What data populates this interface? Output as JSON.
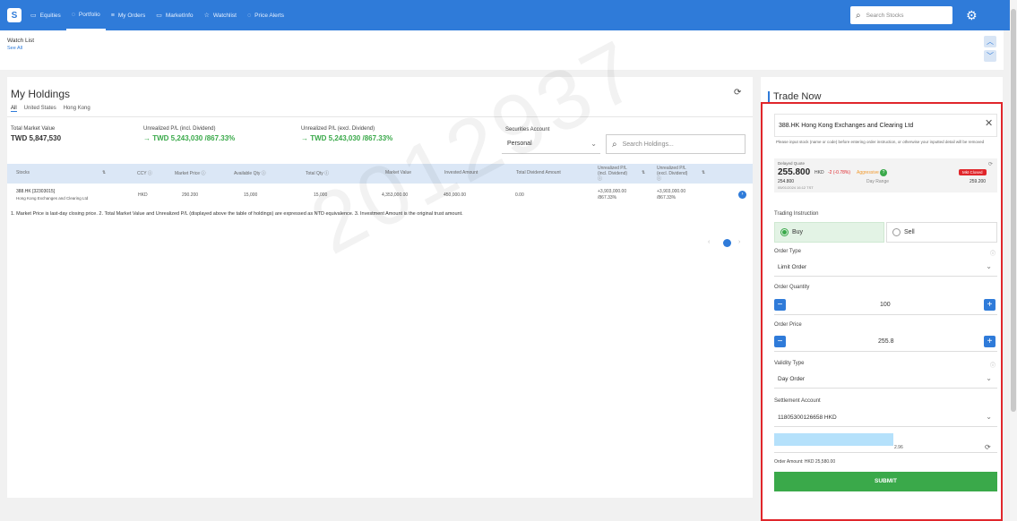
{
  "nav": {
    "logo": "S",
    "items": [
      {
        "icon": "▭",
        "label": "Equities"
      },
      {
        "icon": "◌",
        "label": "Portfolio"
      },
      {
        "icon": "≡",
        "label": "My Orders"
      },
      {
        "icon": "▭",
        "label": "MarketInfo"
      },
      {
        "icon": "☆",
        "label": "Watchlist"
      },
      {
        "icon": "◌",
        "label": "Price Alerts"
      }
    ],
    "search_placeholder": "Search Stocks",
    "search_icon": "search-icon",
    "settings_icon": "gear-icon"
  },
  "watchlist": {
    "title": "Watch List",
    "see_all": "See All"
  },
  "holdings": {
    "title": "My Holdings",
    "tabs": [
      "All",
      "United States",
      "Hong Kong"
    ],
    "total_market_value_label": "Total Market Value",
    "total_market_value": "TWD 5,847,530",
    "unrealized_incl_label": "Unrealized P/L (incl. Dividend)",
    "unrealized_incl": "→ TWD 5,243,030 /867.33%",
    "unrealized_excl_label": "Unrealized P/L (excl. Dividend)",
    "unrealized_excl": "→ TWD 5,243,030 /867.33%",
    "securities_account_label": "Securities Account",
    "securities_account": "Personal",
    "search_placeholder": "Search Holdings...",
    "columns": [
      "Stocks",
      "CCY ⓘ",
      "Market Price ⓘ",
      "Available Qty ⓘ",
      "Total Qty ⓘ",
      "Market Value",
      "Invested Amount",
      "Total Dividend Amount",
      "Unrealized P/L (incl. Dividend) ⓘ",
      "Unrealized P/L (excl. Dividend) ⓘ"
    ],
    "rows": [
      {
        "stock_code": "388.HK [32303015]",
        "stock_name": "Hong Kong Exchanges and Clearing Ltd",
        "ccy": "HKD",
        "market_price": "290.200",
        "available_qty": "15,000",
        "total_qty": "15,000",
        "market_value": "4,353,000.00",
        "invested_amount": "450,000.00",
        "total_dividend": "0.00",
        "pl_incl": "+3,903,000.00",
        "pl_incl_pct": "/867.33%",
        "pl_excl": "+3,903,000.00",
        "pl_excl_pct": "/867.33%"
      }
    ],
    "note": "1. Market Price is last-day closing price.  2. Total Market Value and Unrealized P/L (displayed above the table of holdings) are expressed as NTD equivalence.  3. Investment Amount is the original trust amount.",
    "page": "1"
  },
  "watermark": "2012937",
  "trade": {
    "title": "Trade Now",
    "stock": "388.HK Hong Kong Exchanges and Clearing Ltd",
    "warning": "Please input stock (name or code) before entering order instruction, or otherwise your inputted detail will be removed",
    "delayed_quote_label": "Delayed Quote",
    "price": "255.800",
    "ccy": "HKD",
    "change": "-2 (-0.78%)",
    "aggressive": "Aggressive",
    "market_status": "Mkt Closed",
    "day_low": "254.800",
    "timestamp": "05/01/2024 16:12 TST",
    "day_range_label": "Day Range",
    "day_high": "259.200",
    "trading_instruction_label": "Trading Instruction",
    "buy": "Buy",
    "sell": "Sell",
    "order_type_label": "Order Type",
    "order_type": "Limit Order",
    "order_quantity_label": "Order Quantity",
    "order_quantity": "100",
    "order_price_label": "Order Price",
    "order_price": "255.8",
    "validity_type_label": "Validity Type",
    "validity_type": "Day Order",
    "settlement_account_label": "Settlement Account",
    "settlement_account": "11805300126658 HKD",
    "balance_suffix": "2.96",
    "order_amount": "Order Amount: HKD 25,580.00",
    "submit": "SUBMIT"
  },
  "colors": {
    "primary": "#2f7bd9",
    "green": "#3aa94a",
    "red": "#e0262b"
  }
}
